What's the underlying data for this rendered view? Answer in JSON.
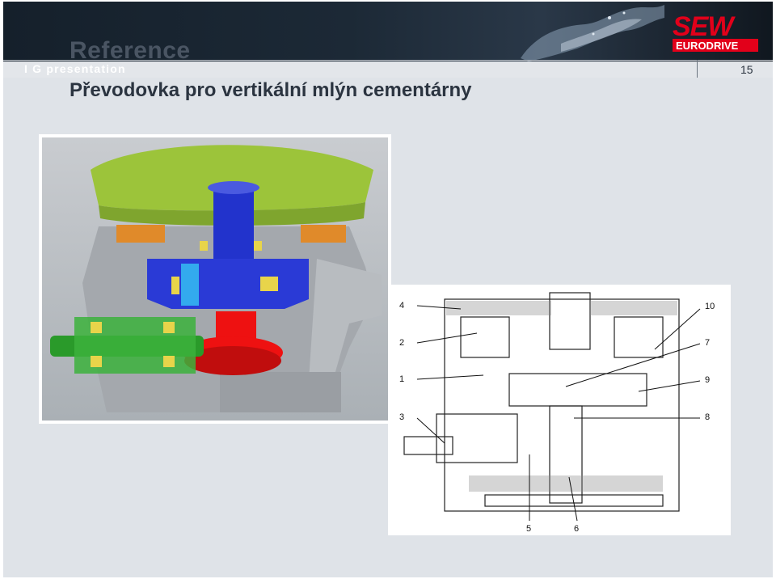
{
  "header": {
    "watermark": "Reference",
    "section": "I G presentation",
    "page_number": "15",
    "logo": {
      "line1": "SEW",
      "line2": "EURODRIVE",
      "color": "#e2001a"
    }
  },
  "slide": {
    "title": "Převodovka pro vertikální mlýn cementárny"
  },
  "drawing_labels": {
    "l4": "4",
    "l2": "2",
    "l1": "1",
    "l3": "3",
    "l10": "10",
    "l7": "7",
    "l9": "9",
    "l8": "8",
    "l5": "5",
    "l6": "6"
  },
  "colors": {
    "table_green": "#9cc43a",
    "shaft_blue": "#2233cc",
    "bearing_yellow": "#e8d44a",
    "orange_part": "#e08a2a",
    "gear_red": "#ee1111",
    "pinion_green": "#2a9a2a",
    "housing_grey": "#a4a8ad"
  }
}
